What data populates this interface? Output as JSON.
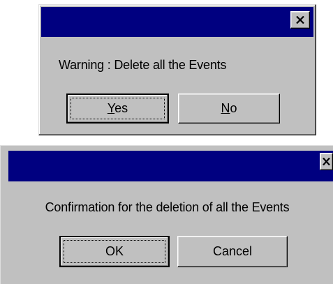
{
  "warning_dialog": {
    "title": "",
    "message": "Warning : Delete all the Events",
    "yes_label": "Yes",
    "yes_mnemonic": "Y",
    "yes_rest": "es",
    "no_label": "No",
    "no_mnemonic": "N",
    "no_rest": "o",
    "close_icon": "close-icon"
  },
  "confirm_dialog": {
    "title": "",
    "message": "Confirmation for the deletion of all the Events",
    "ok_label": "OK",
    "cancel_label": "Cancel",
    "close_icon": "close-icon"
  },
  "colors": {
    "titlebar": "#000080",
    "face": "#c0c0c0",
    "text": "#000000"
  }
}
